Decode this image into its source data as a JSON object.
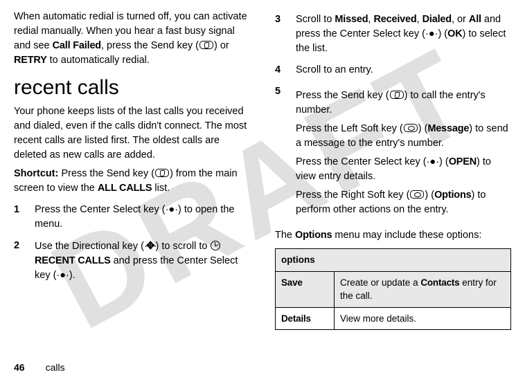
{
  "watermark": "DRAFT",
  "left": {
    "intro_1a": "When automatic redial is turned off, you can activate redial manually. When you hear a fast busy signal and see ",
    "call_failed": "Call Failed",
    "intro_1b": ", press the Send key (",
    "intro_1c": ") or ",
    "retry": "RETRY",
    "intro_1d": " to automatically redial.",
    "heading": "recent calls",
    "para2": "Your phone keeps lists of the last calls you received and dialed, even if the calls didn't connect. The most recent calls are listed first. The oldest calls are deleted as new calls are added.",
    "shortcut_label": "Shortcut:",
    "shortcut_a": " Press the Send key (",
    "shortcut_b": ") from the main screen to view the ",
    "shortcut_allcalls": "ALL CALLS",
    "shortcut_c": " list.",
    "steps": {
      "1": {
        "num": "1",
        "a": "Press the Center Select key (",
        "b": ") to open the menu."
      },
      "2": {
        "num": "2",
        "a": "Use the Directional key (",
        "b": ") to scroll to ",
        "recent": "RECENT CALLS",
        "c": " and press the Center Select key (",
        "d": ")."
      }
    }
  },
  "right": {
    "steps": {
      "3": {
        "num": "3",
        "a": "Scroll to ",
        "missed": "Missed",
        "sep1": ", ",
        "received": "Received",
        "sep2": ", ",
        "dialed": "Dialed",
        "sep3": ", or ",
        "all": "All",
        "b": " and press the Center Select key (",
        "c": ") (",
        "ok": "OK",
        "d": ") to select the list."
      },
      "4": {
        "num": "4",
        "text": "Scroll to an entry."
      },
      "5": {
        "num": "5",
        "a": "Press the Send key (",
        "b": ") to call the entry's number.",
        "p2a": "Press the Left Soft key (",
        "p2b": ") (",
        "message": "Message",
        "p2c": ") to send a message to the entry's number.",
        "p3a": "Press the Center Select key (",
        "p3b": ") (",
        "open": "OPEN",
        "p3c": ") to view entry details.",
        "p4a": "Press the Right Soft key (",
        "p4b": ") (",
        "options": "Options",
        "p4c": ") to perform other actions on the entry."
      }
    },
    "options_intro_a": "The ",
    "options_intro_b": "Options",
    "options_intro_c": " menu may include these options:",
    "table": {
      "header": "options",
      "rows": [
        {
          "name": "Save",
          "desc_a": "Create or update a ",
          "desc_bold": "Contacts",
          "desc_b": " entry for the call."
        },
        {
          "name": "Details",
          "desc_a": "View more details.",
          "desc_bold": "",
          "desc_b": ""
        }
      ]
    }
  },
  "footer": {
    "page": "46",
    "section": "calls"
  }
}
